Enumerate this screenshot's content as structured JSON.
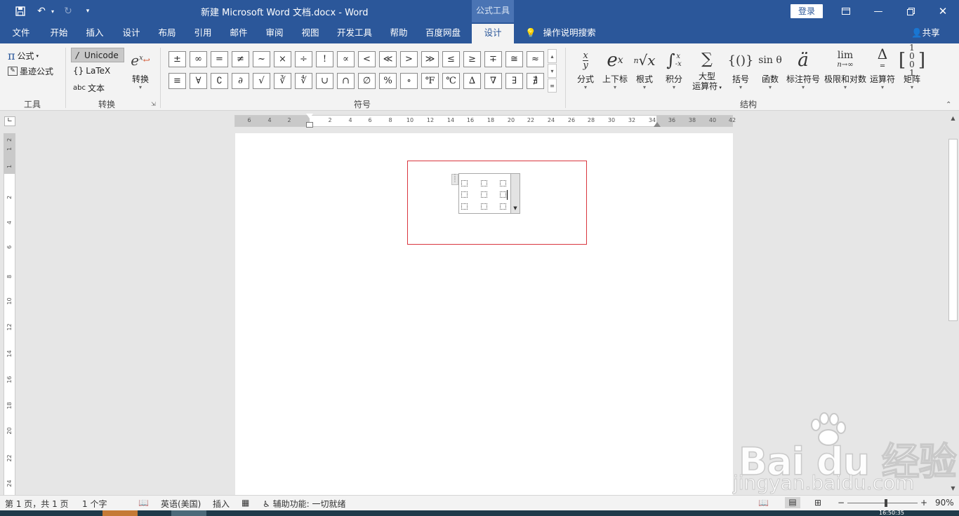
{
  "titlebar": {
    "doc_title": "新建 Microsoft Word 文档.docx  -  Word",
    "context_tab_group": "公式工具",
    "signin": "登录",
    "save_icon": "save-icon",
    "undo_icon": "undo-icon",
    "redo_icon": "redo-icon"
  },
  "tabs": [
    "文件",
    "开始",
    "插入",
    "设计",
    "布局",
    "引用",
    "邮件",
    "审阅",
    "视图",
    "开发工具",
    "帮助",
    "百度网盘",
    "设计"
  ],
  "active_tab_index": 12,
  "tellme": "操作说明搜索",
  "share": "共享",
  "ribbon": {
    "tools": {
      "equation": "公式",
      "ink_equation": "墨迹公式",
      "group_label": "工具"
    },
    "convert": {
      "unicode": "Unicode",
      "latex": "LaTeX",
      "text": "文本",
      "convert_btn": "转换",
      "group_label": "转换"
    },
    "symbols": {
      "row1": [
        "±",
        "∞",
        "=",
        "≠",
        "~",
        "×",
        "÷",
        "!",
        "∝",
        "<",
        "≪",
        ">",
        "≫",
        "≤",
        "≥",
        "∓",
        "≅",
        "≈"
      ],
      "row2": [
        "≡",
        "∀",
        "∁",
        "∂",
        "√",
        "∛",
        "∜",
        "∪",
        "∩",
        "∅",
        "%",
        "∘",
        "℉",
        "℃",
        "∆",
        "∇",
        "∃",
        "∄"
      ],
      "group_label": "符号"
    },
    "structures": {
      "items": [
        {
          "label": "分式",
          "glyph": "x/y"
        },
        {
          "label": "上下标",
          "glyph": "eˣ"
        },
        {
          "label": "根式",
          "glyph": "ⁿ√x"
        },
        {
          "label": "积分",
          "glyph": "∫"
        },
        {
          "label": "大型\n运算符",
          "glyph": "∑"
        },
        {
          "label": "括号",
          "glyph": "{()}"
        },
        {
          "label": "函数",
          "glyph": "sin θ"
        },
        {
          "label": "标注符号",
          "glyph": "ä"
        },
        {
          "label": "极限和对数",
          "glyph": "lim"
        },
        {
          "label": "运算符",
          "glyph": "Δ"
        },
        {
          "label": "矩阵",
          "glyph": "[10 01]"
        }
      ],
      "group_label": "结构"
    }
  },
  "ruler": {
    "horizontal_labels": [
      "6",
      "4",
      "2",
      "2",
      "4",
      "6",
      "8",
      "10",
      "12",
      "14",
      "16",
      "18",
      "20",
      "22",
      "24",
      "26",
      "28",
      "30",
      "32",
      "34",
      "36",
      "38",
      "40",
      "42"
    ],
    "vertical_labels": [
      "2",
      "1",
      "1",
      "2",
      "4",
      "6",
      "8",
      "10",
      "12",
      "14",
      "16",
      "18",
      "20",
      "22",
      "24"
    ]
  },
  "status": {
    "page": "第 1 页，共 1 页",
    "words": "1 个字",
    "language": "英语(美国)",
    "mode": "插入",
    "accessibility": "辅助功能: 一切就绪",
    "zoom": "90%",
    "zoom_fraction": 0.55,
    "clock": "16:50:35"
  },
  "watermark": {
    "logo": "Bai du 经验",
    "url": "jingyan.baidu.com"
  },
  "colors": {
    "brand": "#2b579a",
    "highlight_border": "#d9363e"
  }
}
